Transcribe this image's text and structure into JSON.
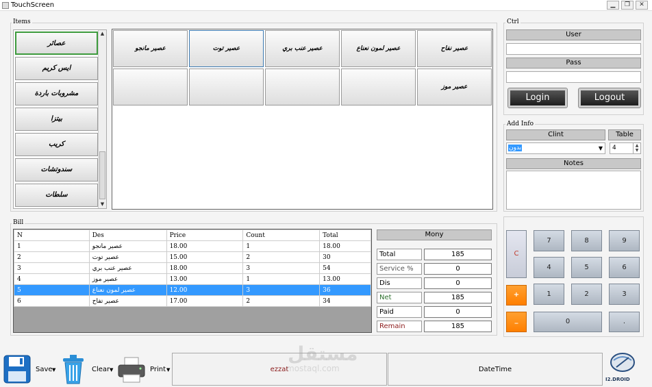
{
  "window": {
    "title": "TouchScreen",
    "min": "▁",
    "max": "❐",
    "close": "✕"
  },
  "items": {
    "label": "Items",
    "categories": [
      "عصائر",
      "ايس كريم",
      "مشروبات باردة",
      "بيتزا",
      "كريب",
      "سندوتشات",
      "سلطات"
    ],
    "products": [
      "عصير نفاح",
      "عصير لمون نعناع",
      "عصير عنب بري",
      "عصير توت",
      "عصير مانجو",
      "عصير موز",
      "",
      "",
      "",
      ""
    ]
  },
  "ctrl": {
    "label": "Ctrl",
    "user": "User",
    "pass": "Pass",
    "login": "Login",
    "logout": "Logout"
  },
  "addinfo": {
    "label": "Add Info",
    "client_header": "Clint",
    "table_header": "Table",
    "client_value": "بدون",
    "table_value": "4",
    "notes": "Notes"
  },
  "bill": {
    "label": "Bill",
    "columns": [
      "N",
      "Des",
      "Price",
      "Count",
      "Total"
    ],
    "rows": [
      [
        "1",
        "عصير مانجو",
        "18.00",
        "1",
        "18.00"
      ],
      [
        "2",
        "عصير توت",
        "15.00",
        "2",
        "30"
      ],
      [
        "3",
        "عصير عنب بري",
        "18.00",
        "3",
        "54"
      ],
      [
        "4",
        "عصير موز",
        "13.00",
        "1",
        "13.00"
      ],
      [
        "5",
        "عصير لمون نعناع",
        "12.00",
        "3",
        "36"
      ],
      [
        "6",
        "عصير تفاح",
        "17.00",
        "2",
        "34"
      ]
    ]
  },
  "money": {
    "header": "Mony",
    "rows": [
      {
        "label": "Total",
        "value": "185"
      },
      {
        "label": "Service %",
        "value": "0"
      },
      {
        "label": "Dis",
        "value": "0"
      },
      {
        "label": "Net",
        "value": "185"
      },
      {
        "label": "Paid",
        "value": "0"
      },
      {
        "label": "Remain",
        "value": "185"
      }
    ]
  },
  "keypad": {
    "c": "C",
    "plus": "+",
    "minus": "_",
    "dot": ".",
    "keys": [
      "7",
      "8",
      "9",
      "4",
      "5",
      "6",
      "1",
      "2",
      "3",
      "0"
    ]
  },
  "toolbar": {
    "save": "Save",
    "clear": "Clear",
    "print": "Print",
    "user_status": "ezzat",
    "datetime": "DateTime",
    "logo_text": "I2.DROID"
  },
  "watermark": {
    "ar": "مستقل",
    "url": "mostaql.com"
  }
}
